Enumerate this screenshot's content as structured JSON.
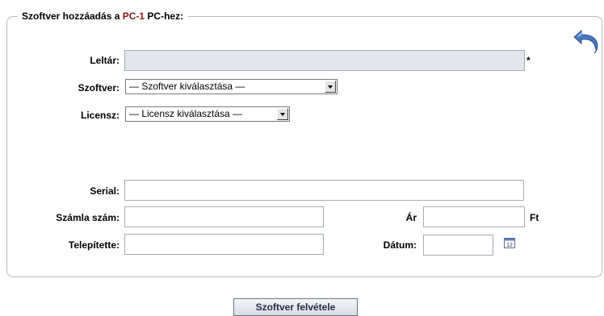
{
  "form": {
    "legend_prefix": "Szoftver hozzáadás a ",
    "legend_pc": "PC-1",
    "legend_suffix": " PC-hez:",
    "back_icon": "undo-arrow-icon",
    "leltar": {
      "label": "Leltár:",
      "value": "",
      "required_mark": "*"
    },
    "szoftver": {
      "label": "Szoftver:",
      "selected": "— Szoftver kiválasztása —"
    },
    "licensz": {
      "label": "Licensz:",
      "selected": "— Licensz kiválasztása —"
    },
    "serial": {
      "label": "Serial:",
      "value": ""
    },
    "szamla": {
      "label": "Számla szám:",
      "value": ""
    },
    "ar": {
      "label": "Ár",
      "value": "",
      "unit": "Ft"
    },
    "telepitette": {
      "label": "Telepítette:",
      "value": ""
    },
    "datum": {
      "label": "Dátum:",
      "value": "",
      "calendar_icon": "calendar-icon",
      "calendar_day": "12"
    },
    "submit_label": "Szoftver felvétele"
  },
  "colors": {
    "pc_name": "#8b1a1a",
    "border": "#b9b9b9",
    "disabled_input": "#e3e6ec",
    "back_icon": "#4a78c2"
  }
}
